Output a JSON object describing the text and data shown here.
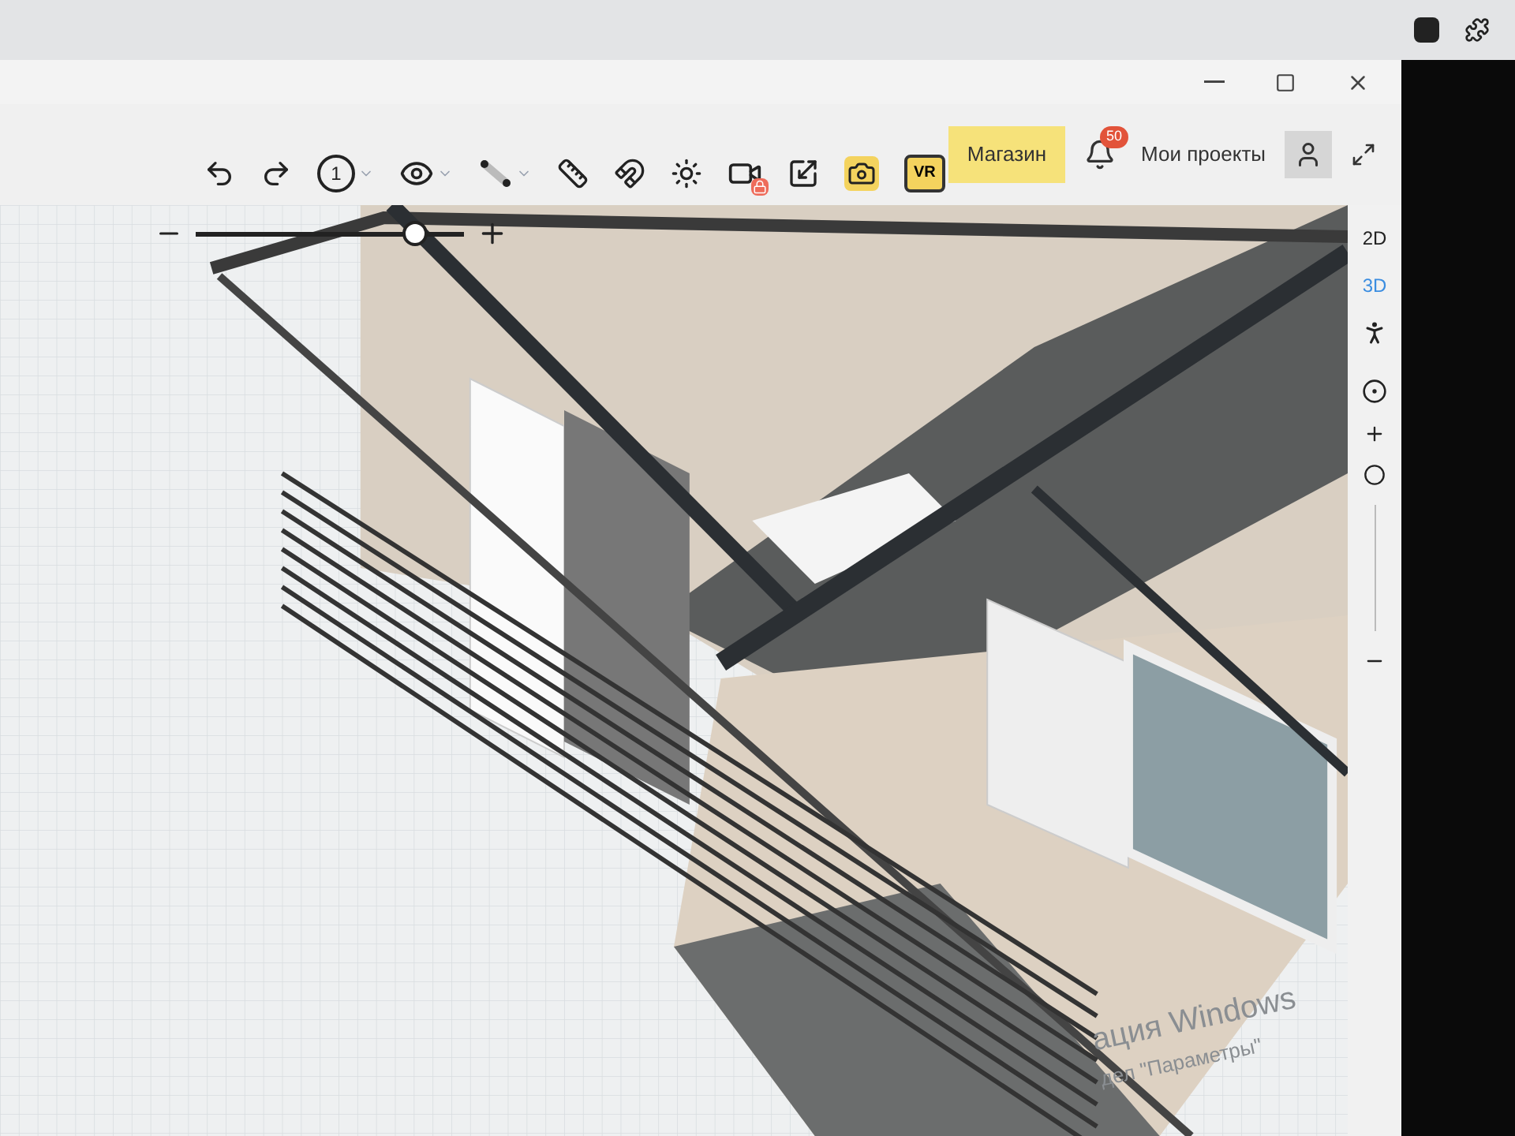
{
  "toolbar": {
    "floor": "1",
    "tools": [
      {
        "kind": "undo"
      },
      {
        "kind": "redo"
      },
      {
        "kind": "floor"
      },
      {
        "kind": "view"
      },
      {
        "kind": "wall"
      },
      {
        "kind": "ruler"
      },
      {
        "kind": "magnet"
      },
      {
        "kind": "light"
      },
      {
        "kind": "video"
      },
      {
        "kind": "resize"
      },
      {
        "kind": "photo"
      },
      {
        "kind": "vr",
        "label": "VR"
      }
    ]
  },
  "header": {
    "shop": "Магазин",
    "notifications": "50",
    "projects": "Мои проекты"
  },
  "view_modes": [
    {
      "label": "2D",
      "selected": false
    },
    {
      "label": "3D",
      "selected": true
    }
  ],
  "zoom": {
    "level": 0.82
  },
  "activation": {
    "title": "ация Windows",
    "text": "дел \"Параметры\""
  }
}
